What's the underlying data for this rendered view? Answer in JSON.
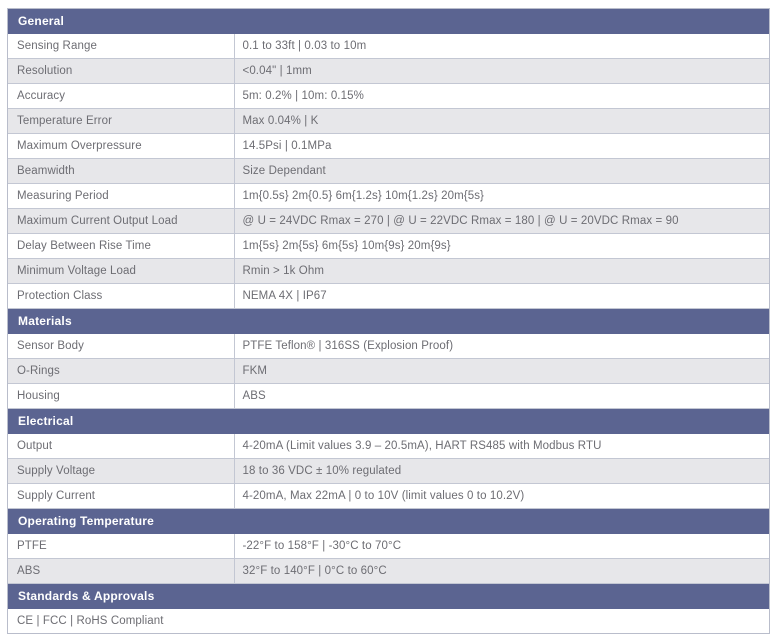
{
  "document": {
    "type": "specification-table",
    "colors": {
      "section_header_bg": "#5b6491",
      "section_header_text": "#ffffff",
      "row_shaded_bg": "#e7e7ea",
      "row_plain_bg": "#ffffff",
      "body_text": "#6d6d73",
      "border": "#c3c7d3"
    }
  },
  "sections": [
    {
      "title": "General",
      "rows": [
        {
          "label": "Sensing Range",
          "value": "0.1 to 33ft | 0.03 to 10m"
        },
        {
          "label": "Resolution",
          "value": "<0.04\" | 1mm"
        },
        {
          "label": "Accuracy",
          "value": "5m: 0.2% | 10m: 0.15%"
        },
        {
          "label": "Temperature Error",
          "value": "Max 0.04% | K"
        },
        {
          "label": "Maximum Overpressure",
          "value": "14.5Psi | 0.1MPa"
        },
        {
          "label": "Beamwidth",
          "value": "Size Dependant"
        },
        {
          "label": "Measuring Period",
          "value": "1m{0.5s} 2m{0.5} 6m{1.2s} 10m{1.2s} 20m{5s}"
        },
        {
          "label": "Maximum Current Output Load",
          "value": "@ U = 24VDC  Rmax = 270  |  @ U = 22VDC  Rmax = 180  |  @ U = 20VDC  Rmax = 90"
        },
        {
          "label": "Delay Between Rise Time",
          "value": "1m{5s} 2m{5s} 6m{5s} 10m{9s} 20m{9s}"
        },
        {
          "label": "Minimum Voltage Load",
          "value": "Rmin > 1k Ohm"
        },
        {
          "label": "Protection Class",
          "value": "NEMA 4X | IP67"
        }
      ]
    },
    {
      "title": "Materials",
      "rows": [
        {
          "label": "Sensor Body",
          "value": "PTFE Teflon®  |  316SS (Explosion Proof)"
        },
        {
          "label": "O-Rings",
          "value": "FKM"
        },
        {
          "label": "Housing",
          "value": "ABS"
        }
      ]
    },
    {
      "title": "Electrical",
      "rows": [
        {
          "label": "Output",
          "value": "4-20mA (Limit values 3.9 – 20.5mA), HART RS485 with Modbus RTU"
        },
        {
          "label": "Supply Voltage",
          "value": "18 to 36 VDC ± 10% regulated"
        },
        {
          "label": "Supply Current",
          "value": "4-20mA, Max 22mA | 0 to 10V (limit values 0 to 10.2V)"
        }
      ]
    },
    {
      "title": "Operating Temperature",
      "rows": [
        {
          "label": "PTFE",
          "value": "-22°F to 158°F  |  -30°C to 70°C"
        },
        {
          "label": "ABS",
          "value": "32°F to 140°F  |  0°C to 60°C"
        }
      ]
    },
    {
      "title": "Standards & Approvals",
      "rows": [
        {
          "full": "CE | FCC | RoHS Compliant"
        }
      ]
    }
  ]
}
